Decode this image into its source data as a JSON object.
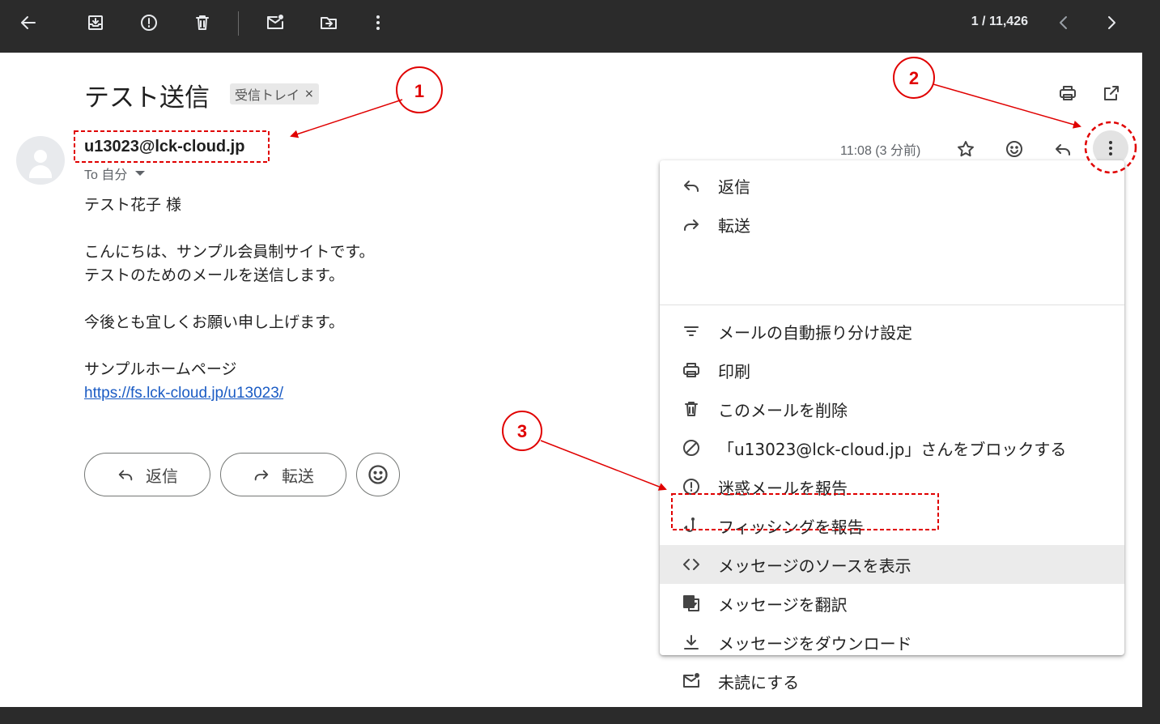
{
  "topbar": {
    "icons": [
      "back-arrow-icon",
      "archive-icon",
      "report-spam-icon",
      "delete-icon",
      "mark-unread-icon",
      "move-to-icon",
      "more-vert-icon"
    ],
    "counter": "1 / 11,426",
    "nav_icons": [
      "chevron-left-icon",
      "chevron-right-icon"
    ]
  },
  "email": {
    "subject": "テスト送信",
    "label": "受信トレイ",
    "label_close": "×",
    "sender": "u13023@lck-cloud.jp",
    "to_line": "To 自分",
    "time": "11:08 (3 分前)",
    "body": {
      "greeting": "テスト花子 様",
      "line1": "こんにちは、サンプル会員制サイトです。",
      "line2": "テストのためのメールを送信します。",
      "line3": "今後とも宜しくお願い申し上げます。",
      "signature": "サンプルホームページ",
      "link": "https://fs.lck-cloud.jp/u13023/"
    },
    "reply_label": "返信",
    "forward_label": "転送"
  },
  "menu": {
    "items": [
      {
        "label": "返信",
        "icon": "reply-icon"
      },
      {
        "label": "転送",
        "icon": "forward-icon"
      },
      {
        "label": "メールの自動振り分け設定",
        "icon": "filter-icon"
      },
      {
        "label": "印刷",
        "icon": "print-icon"
      },
      {
        "label": "このメールを削除",
        "icon": "delete-icon"
      },
      {
        "label": "「u13023@lck-cloud.jp」さんをブロックする",
        "icon": "block-icon"
      },
      {
        "label": "迷惑メールを報告",
        "icon": "report-spam-icon"
      },
      {
        "label": "フィッシングを報告",
        "icon": "phishing-hook-icon"
      },
      {
        "label": "メッセージのソースを表示",
        "icon": "code-icon"
      },
      {
        "label": "メッセージを翻訳",
        "icon": "translate-icon"
      },
      {
        "label": "メッセージをダウンロード",
        "icon": "download-icon"
      },
      {
        "label": "未読にする",
        "icon": "mark-unread-icon"
      }
    ]
  },
  "annotations": {
    "markers": [
      "1",
      "2",
      "3"
    ],
    "color": "#e00000"
  }
}
